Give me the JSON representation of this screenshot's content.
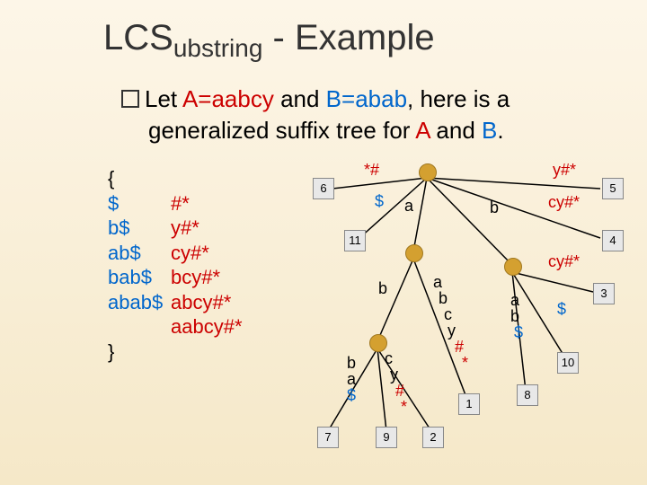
{
  "title": {
    "prefix": "LCS",
    "sub": "ubstring",
    "suffix": " - Example"
  },
  "bullet": {
    "let": "Let ",
    "a_eq": "A=aabcy",
    "mid": " and ",
    "b_eq": "B=abab",
    "tail": ", here is a",
    "line2_a": "generalized suffix tree for ",
    "A": "A",
    "and2": " and ",
    "B": "B",
    "dot": "."
  },
  "suffixes": {
    "open": "{",
    "rows": [
      {
        "a": "$",
        "b": "#*"
      },
      {
        "a": "b$",
        "b": "y#*"
      },
      {
        "a": "ab$",
        "b": "cy#*"
      },
      {
        "a": "bab$",
        "b": "bcy#*"
      },
      {
        "a": "abab$",
        "b": "abcy#*"
      },
      {
        "a": "",
        "b": "aabcy#*"
      }
    ],
    "close": "}"
  },
  "leaves": {
    "n6": "6",
    "n5": "5",
    "n11": "11",
    "n4": "4",
    "n3": "3",
    "n10": "10",
    "n8": "8",
    "n1": "1",
    "n7": "7",
    "n9": "9",
    "n2": "2"
  },
  "edges": {
    "e1": "*#",
    "e2": "$",
    "e3": "a",
    "e4": "b",
    "e5": "y#*",
    "e6": "cy#*",
    "e7": "cy#*",
    "e8": "b",
    "e9a": "a",
    "e9b": "b",
    "e9c": "c",
    "e9d": "y",
    "e9e": "#",
    "e9f": "*",
    "e10a": "a",
    "e10b": "b",
    "e10c": "$",
    "e11": "$",
    "e12a": "b",
    "e12b": "a",
    "e12c": "$",
    "e13a": "c",
    "e13b": "y",
    "e13c": "#",
    "e13d": "*"
  },
  "chart_data": {
    "type": "diagram",
    "description": "Generalized suffix tree for A=aabcy (red, terminator #*) and B=abab (blue, terminator $)",
    "root": {
      "children": [
        {
          "edge": "*#",
          "leaf": 6,
          "color": "red"
        },
        {
          "edge": "$",
          "leaf": 11,
          "color": "blue"
        },
        {
          "edge": "a",
          "children": [
            {
              "edge": "b",
              "children": [
                {
                  "edge": "ba$",
                  "leaf": 7,
                  "color": "blue"
                },
                {
                  "edge": "cy#*",
                  "leaf": 9,
                  "color": "red"
                },
                {
                  "edge": "abcy#*",
                  "leaf": 2,
                  "color": "red"
                }
              ]
            },
            {
              "edge": "abcy#*",
              "leaf": 1,
              "color": "red"
            }
          ]
        },
        {
          "edge": "b",
          "children": [
            {
              "edge": "ab$",
              "leaf": 8,
              "color": "blue"
            },
            {
              "edge": "$",
              "leaf": 10,
              "color": "blue"
            },
            {
              "edge": "cy#*",
              "leaf": 3,
              "color": "red"
            }
          ]
        },
        {
          "edge": "y#*",
          "leaf": 5,
          "color": "red"
        },
        {
          "edge": "cy#*",
          "leaf": 4,
          "color": "red"
        }
      ]
    }
  }
}
